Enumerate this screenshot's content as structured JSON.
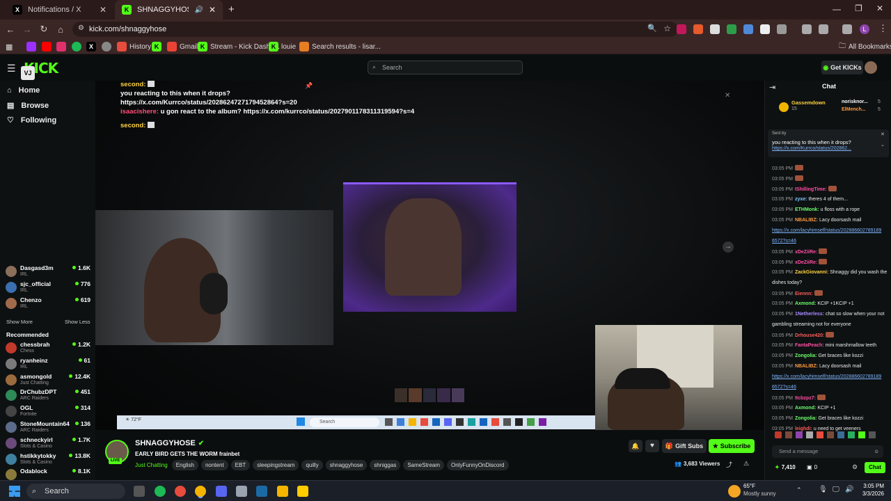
{
  "browser": {
    "tabs": [
      {
        "title": "Notifications / X",
        "active": false
      },
      {
        "title": "SHNAGGYHOSE Stream - V",
        "active": true
      }
    ],
    "url": "kick.com/shnaggyhose",
    "bookmarks": [
      "History",
      "Gmail",
      "Stream - Kick Dashb...",
      "louie",
      "Search results - lisar..."
    ],
    "all_bookmarks": "All Bookmarks"
  },
  "header": {
    "logo": "KICK",
    "search_placeholder": "Search",
    "get_kicks": "Get KICKs"
  },
  "sidebar": {
    "nav": [
      "Home",
      "Browse",
      "Following"
    ],
    "following": [
      {
        "name": "Dasgasd3m",
        "category": "IRL",
        "viewers": "1.6K",
        "color": "#8b6f5a"
      },
      {
        "name": "sjc_official",
        "category": "IRL",
        "viewers": "776",
        "color": "#3a6fb0"
      },
      {
        "name": "Chenzo",
        "category": "IRL",
        "viewers": "619",
        "color": "#a06b4b"
      }
    ],
    "show_more": "Show More",
    "show_less": "Show Less",
    "recommended_title": "Recommended",
    "recommended": [
      {
        "name": "chessbrah",
        "category": "Chess",
        "viewers": "1.2K",
        "color": "#c0392b"
      },
      {
        "name": "ryanheinz",
        "category": "IRL",
        "viewers": "61",
        "color": "#7a7a7a"
      },
      {
        "name": "asmongold",
        "category": "Just Chatting",
        "viewers": "12.4K",
        "color": "#9b6b3d"
      },
      {
        "name": "DrChubzDPT",
        "category": "ARC Raiders",
        "viewers": "451",
        "color": "#2e8b57"
      },
      {
        "name": "OGL",
        "category": "Fortnite",
        "viewers": "314",
        "color": "#444"
      },
      {
        "name": "StoneMountain64",
        "category": "ARC Raiders",
        "viewers": "136",
        "color": "#5b6b8a"
      },
      {
        "name": "schneckyirl",
        "category": "Slots & Casino",
        "viewers": "1.7K",
        "color": "#6a4a7a"
      },
      {
        "name": "hstikkytokky",
        "category": "Slots & Casino",
        "viewers": "13.8K",
        "color": "#3f7f9f"
      },
      {
        "name": "Odablock",
        "category": "",
        "viewers": "8.1K",
        "color": "#8a7a3a"
      }
    ]
  },
  "stream": {
    "overlay_chat": [
      {
        "user": "second:",
        "text": ""
      },
      {
        "user": "",
        "text": "you reacting to this when it drops?"
      },
      {
        "user": "",
        "text": "https://x.com/Kurrco/status/2028624727179452864?s=20"
      },
      {
        "user": "isaacishere:",
        "text": "u gon react to the album? https://x.com/kurrco/status/2027901178311319594?s=4"
      },
      {
        "user": "second:",
        "text": ""
      }
    ],
    "taskbar_search": "Search"
  },
  "channel": {
    "name": "SHNAGGYHOSE",
    "live_badge": "LIVE",
    "title": "EARLY BIRD GETS THE WORM frainbet",
    "category": "Just Chatting",
    "tags": [
      "English",
      "nontent",
      "EBT",
      "sleepingstream",
      "quilly",
      "shnaggyhose",
      "shniggas",
      "SameStream",
      "OnlyFunnyOnDiscord"
    ],
    "viewers": "3,683 Viewers",
    "gift_subs": "Gift Subs",
    "subscribe": "Subscribe"
  },
  "chat": {
    "title": "Chat",
    "top_gifters": [
      {
        "name": "Gassemdown",
        "count": "15"
      },
      {
        "name": "norisknor...",
        "count": "5"
      },
      {
        "name": "ElMench...",
        "count": "5"
      }
    ],
    "pinned": {
      "sent_by": "Sent by",
      "text": "you reacting to this when it drops?",
      "link": "https://x.com/Kurrco/status/202862..."
    },
    "messages": [
      {
        "time": "03:05 PM",
        "user": "",
        "color": "#ff5a5a",
        "text": ""
      },
      {
        "time": "03:05 PM",
        "user": "",
        "color": "#ff5a5a",
        "text": ""
      },
      {
        "time": "03:05 PM",
        "user": "IShillingTime:",
        "color": "#ff4fa3",
        "text": ""
      },
      {
        "time": "03:05 PM",
        "user": "zyxe:",
        "color": "#7ec8ff",
        "text": "theres 4 of them..."
      },
      {
        "time": "03:05 PM",
        "user": "ETHMonk:",
        "color": "#6cff6c",
        "text": "u floss with a rope"
      },
      {
        "time": "03:05 PM",
        "user": "NBALIBZ:",
        "color": "#ff9b3d",
        "text": "Lacy doorsash mail"
      },
      {
        "time": "",
        "user": "",
        "color": "",
        "text": "https://x.com/lacyhimself/status/202886602789189"
      },
      {
        "time": "",
        "user": "",
        "color": "",
        "text": "6572?s=46"
      },
      {
        "time": "03:05 PM",
        "user": "xDeZiiRe:",
        "color": "#ff4fa3",
        "text": ""
      },
      {
        "time": "03:05 PM",
        "user": "xDeZiiRe:",
        "color": "#ff4fa3",
        "text": ""
      },
      {
        "time": "03:05 PM",
        "user": "ZackGiovanni:",
        "color": "#ffd23f",
        "text": "Shnaggy did you wash the"
      },
      {
        "time": "",
        "user": "",
        "color": "",
        "text": "dishes today?"
      },
      {
        "time": "03:05 PM",
        "user": "Eiennn:",
        "color": "#ff5a5a",
        "text": ""
      },
      {
        "time": "03:05 PM",
        "user": "Axmond:",
        "color": "#6cff6c",
        "text": "KCIP +1KCIP +1"
      },
      {
        "time": "03:05 PM",
        "user": "1Netherless:",
        "color": "#a98bff",
        "text": "chat so slow when your not"
      },
      {
        "time": "",
        "user": "",
        "color": "",
        "text": "gambling streaming not for everyone"
      },
      {
        "time": "03:05 PM",
        "user": "Drhouse420:",
        "color": "#ff5a5a",
        "text": ""
      },
      {
        "time": "03:05 PM",
        "user": "FantaPeach:",
        "color": "#ff4fa3",
        "text": "mini marshmallow teeth"
      },
      {
        "time": "03:05 PM",
        "user": "Zongolia:",
        "color": "#6cff6c",
        "text": "Get braces like kozzi"
      },
      {
        "time": "03:05 PM",
        "user": "NBALIBZ:",
        "color": "#ff9b3d",
        "text": "Lacy doorsash mail"
      },
      {
        "time": "",
        "user": "",
        "color": "",
        "text": "https://x.com/lacyhimself/status/202886602789189"
      },
      {
        "time": "",
        "user": "",
        "color": "",
        "text": "6572?s=46"
      },
      {
        "time": "03:05 PM",
        "user": "Itcbzpz7:",
        "color": "#ff4fa3",
        "text": ""
      },
      {
        "time": "03:05 PM",
        "user": "Axmond:",
        "color": "#6cff6c",
        "text": "KCIP +1"
      },
      {
        "time": "03:05 PM",
        "user": "Zongolia:",
        "color": "#6cff6c",
        "text": "Get braces like kozzi"
      },
      {
        "time": "03:05 PM",
        "user": "leighdi:",
        "color": "#ff5a5a",
        "text": "u need to get veeners"
      }
    ],
    "input_placeholder": "Send a message",
    "points": "7,410",
    "count": "0",
    "chat_button": "Chat"
  },
  "taskbar": {
    "search": "Search",
    "weather_temp": "65°F",
    "weather_desc": "Mostly sunny",
    "time": "3:05 PM",
    "date": "3/3/2026"
  },
  "colors": {
    "kick_green": "#53fc18",
    "browser_bg": "#3b2626"
  }
}
